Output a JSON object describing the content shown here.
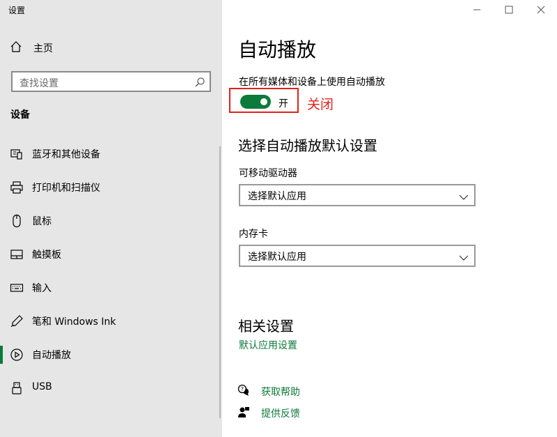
{
  "window": {
    "title": "设置"
  },
  "sidebar": {
    "home_label": "主页",
    "search_placeholder": "查找设置",
    "section_title": "设备",
    "items": [
      {
        "label": "蓝牙和其他设备",
        "icon": "bluetooth-devices-icon"
      },
      {
        "label": "打印机和扫描仪",
        "icon": "printer-icon"
      },
      {
        "label": "鼠标",
        "icon": "mouse-icon"
      },
      {
        "label": "触摸板",
        "icon": "touchpad-icon"
      },
      {
        "label": "输入",
        "icon": "keyboard-icon"
      },
      {
        "label": "笔和 Windows Ink",
        "icon": "pen-icon"
      },
      {
        "label": "自动播放",
        "icon": "autoplay-icon",
        "active": true
      },
      {
        "label": "USB",
        "icon": "usb-icon"
      }
    ]
  },
  "main": {
    "title": "自动播放",
    "toggle_description": "在所有媒体和设备上使用自动播放",
    "toggle_state": "开",
    "annotation": "关闭",
    "defaults_title": "选择自动播放默认设置",
    "removable_drive_label": "可移动驱动器",
    "removable_drive_value": "选择默认应用",
    "memory_card_label": "内存卡",
    "memory_card_value": "选择默认应用",
    "related_title": "相关设置",
    "related_link": "默认应用设置",
    "help_label": "获取帮助",
    "feedback_label": "提供反馈"
  },
  "colors": {
    "accent": "#0b7a3a",
    "annotation": "#e0201a",
    "sidebar_bg": "#e6e6e6"
  }
}
